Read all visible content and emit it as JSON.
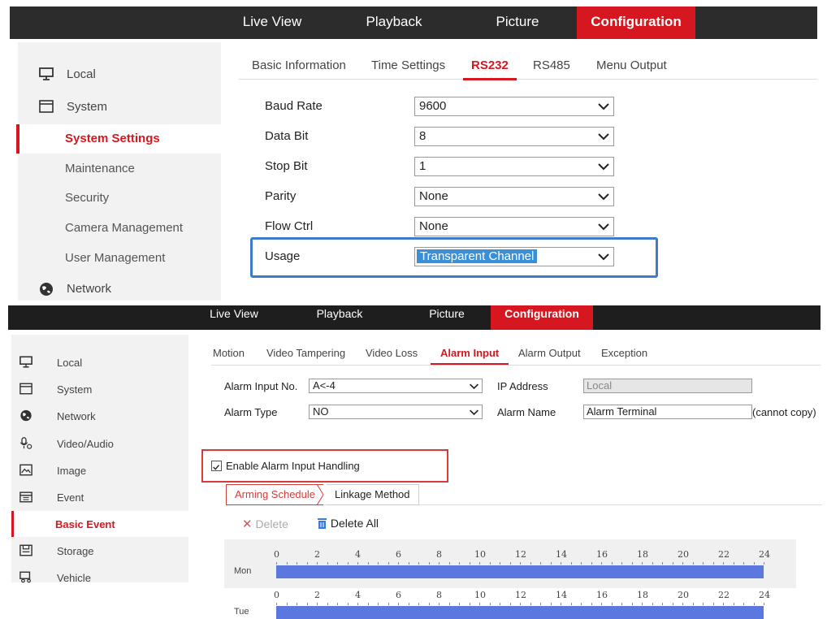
{
  "panel1": {
    "topnav": [
      "Live View",
      "Playback",
      "Picture",
      "Configuration"
    ],
    "sidebar": {
      "items": [
        {
          "label": "Local",
          "icon": "monitor-icon"
        },
        {
          "label": "System",
          "icon": "window-icon"
        },
        {
          "label": "System Settings",
          "active": true
        },
        {
          "label": "Maintenance"
        },
        {
          "label": "Security"
        },
        {
          "label": "Camera Management"
        },
        {
          "label": "User Management"
        },
        {
          "label": "Network",
          "icon": "globe-icon"
        }
      ]
    },
    "tabs": [
      "Basic Information",
      "Time Settings",
      "RS232",
      "RS485",
      "Menu Output"
    ],
    "active_tab": "RS232",
    "fields": [
      {
        "label": "Baud Rate",
        "value": "9600"
      },
      {
        "label": "Data Bit",
        "value": "8"
      },
      {
        "label": "Stop Bit",
        "value": "1"
      },
      {
        "label": "Parity",
        "value": "None"
      },
      {
        "label": "Flow Ctrl",
        "value": "None"
      },
      {
        "label": "Usage",
        "value": "Transparent Channel"
      }
    ]
  },
  "panel2": {
    "topnav": [
      "Live View",
      "Playback",
      "Picture",
      "Configuration"
    ],
    "sidebar": {
      "items": [
        {
          "label": "Local",
          "icon": "monitor-icon"
        },
        {
          "label": "System",
          "icon": "window-icon"
        },
        {
          "label": "Network",
          "icon": "globe-icon"
        },
        {
          "label": "Video/Audio",
          "icon": "microphone-icon"
        },
        {
          "label": "Image",
          "icon": "image-icon"
        },
        {
          "label": "Event",
          "icon": "calendar-icon"
        },
        {
          "label": "Basic Event",
          "active": true
        },
        {
          "label": "Storage",
          "icon": "storage-icon"
        },
        {
          "label": "Vehicle",
          "icon": "vehicle-icon"
        }
      ]
    },
    "tabs": [
      "Motion",
      "Video Tampering",
      "Video Loss",
      "Alarm Input",
      "Alarm Output",
      "Exception"
    ],
    "active_tab": "Alarm Input",
    "form": {
      "alarm_input_no_label": "Alarm Input No.",
      "alarm_input_no_value": "A<-4",
      "ip_address_label": "IP Address",
      "ip_address_value": "Local",
      "alarm_type_label": "Alarm Type",
      "alarm_type_value": "NO",
      "alarm_name_label": "Alarm Name",
      "alarm_name_value": "Alarm Terminal",
      "alarm_name_note": "(cannot copy)",
      "enable_label": "Enable Alarm Input Handling",
      "enable_checked": true
    },
    "subtabs": [
      "Arming Schedule",
      "Linkage Method"
    ],
    "toolbar": {
      "delete_label": "Delete",
      "delete_all_label": "Delete All"
    },
    "schedule": {
      "hours": [
        "0",
        "2",
        "4",
        "6",
        "8",
        "10",
        "12",
        "14",
        "16",
        "18",
        "20",
        "22",
        "24"
      ],
      "days": [
        "Mon",
        "Tue"
      ]
    }
  },
  "colors": {
    "accent": "#d7171f",
    "highlight_box": "#3d7cc9",
    "alert_box": "#d73c3c",
    "schedule_bar": "#5a78e0",
    "topbar": "#2c2c2c"
  }
}
